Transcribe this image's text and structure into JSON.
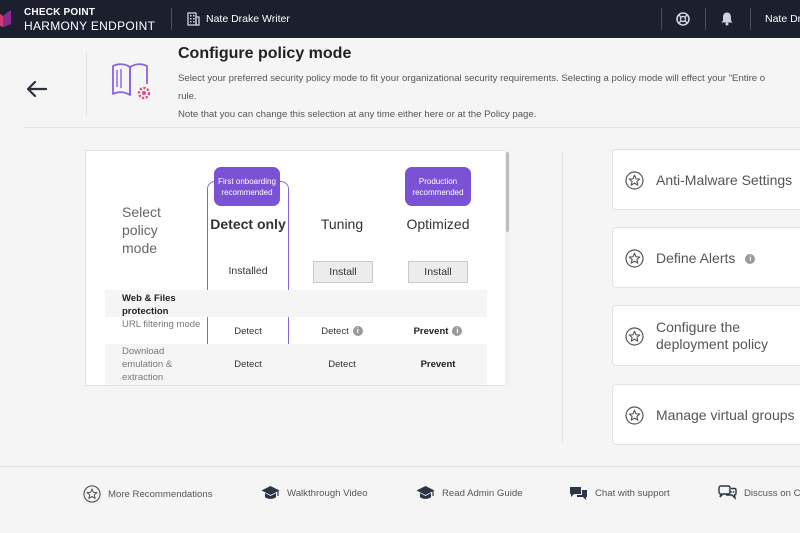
{
  "topbar": {
    "brand_line1": "CHECK POINT",
    "brand_line2": "HARMONY ENDPOINT",
    "org_name": "Nate Drake Writer",
    "user_name": "Nate Dr",
    "icons": [
      "brand-logo-icon",
      "building-icon",
      "help-lifebuoy-icon",
      "bell-icon"
    ]
  },
  "header": {
    "title": "Configure policy mode",
    "description_line1": "Select your preferred security policy mode to fit your organizational security requirements. Selecting a policy mode will effect your \"Entire o",
    "description_line2": "rule.",
    "description_line3": "Note that you can change this selection at any time either here or at the Policy page."
  },
  "policy": {
    "select_label": "Select policy mode",
    "columns": [
      {
        "name": "Detect only",
        "badge": "First onboarding recommended",
        "status": "Installed"
      },
      {
        "name": "Tuning",
        "badge": "",
        "action": "Install"
      },
      {
        "name": "Optimized",
        "badge": "Production recommended",
        "action": "Install"
      }
    ],
    "section": "Web & Files protection",
    "rows": [
      {
        "label": "URL filtering mode",
        "detect_only": "Detect",
        "tuning": "Detect",
        "optimized": "Prevent"
      },
      {
        "label": "Download emulation & extraction",
        "detect_only": "Detect",
        "tuning": "Detect",
        "optimized": "Prevent"
      }
    ]
  },
  "side_cards": [
    {
      "label": "Anti-Malware Settings"
    },
    {
      "label": "Define Alerts"
    },
    {
      "label_line1": "Configure the",
      "label_line2": "deployment policy"
    },
    {
      "label": "Manage virtual groups"
    }
  ],
  "footer": [
    {
      "label": "More Recommendations",
      "icon": "star-circle-icon"
    },
    {
      "label": "Walkthrough Video",
      "icon": "graduation-cap-icon"
    },
    {
      "label": "Read Admin Guide",
      "icon": "graduation-cap-icon"
    },
    {
      "label": "Chat with support",
      "icon": "chat-icon"
    },
    {
      "label": "Discuss on C",
      "icon": "discussion-icon"
    }
  ],
  "colors": {
    "accent_purple": "#7b52d6",
    "topbar": "#1c1f2e",
    "book_icon": "#8a63e0",
    "gear_pink": "#e04b7c"
  }
}
